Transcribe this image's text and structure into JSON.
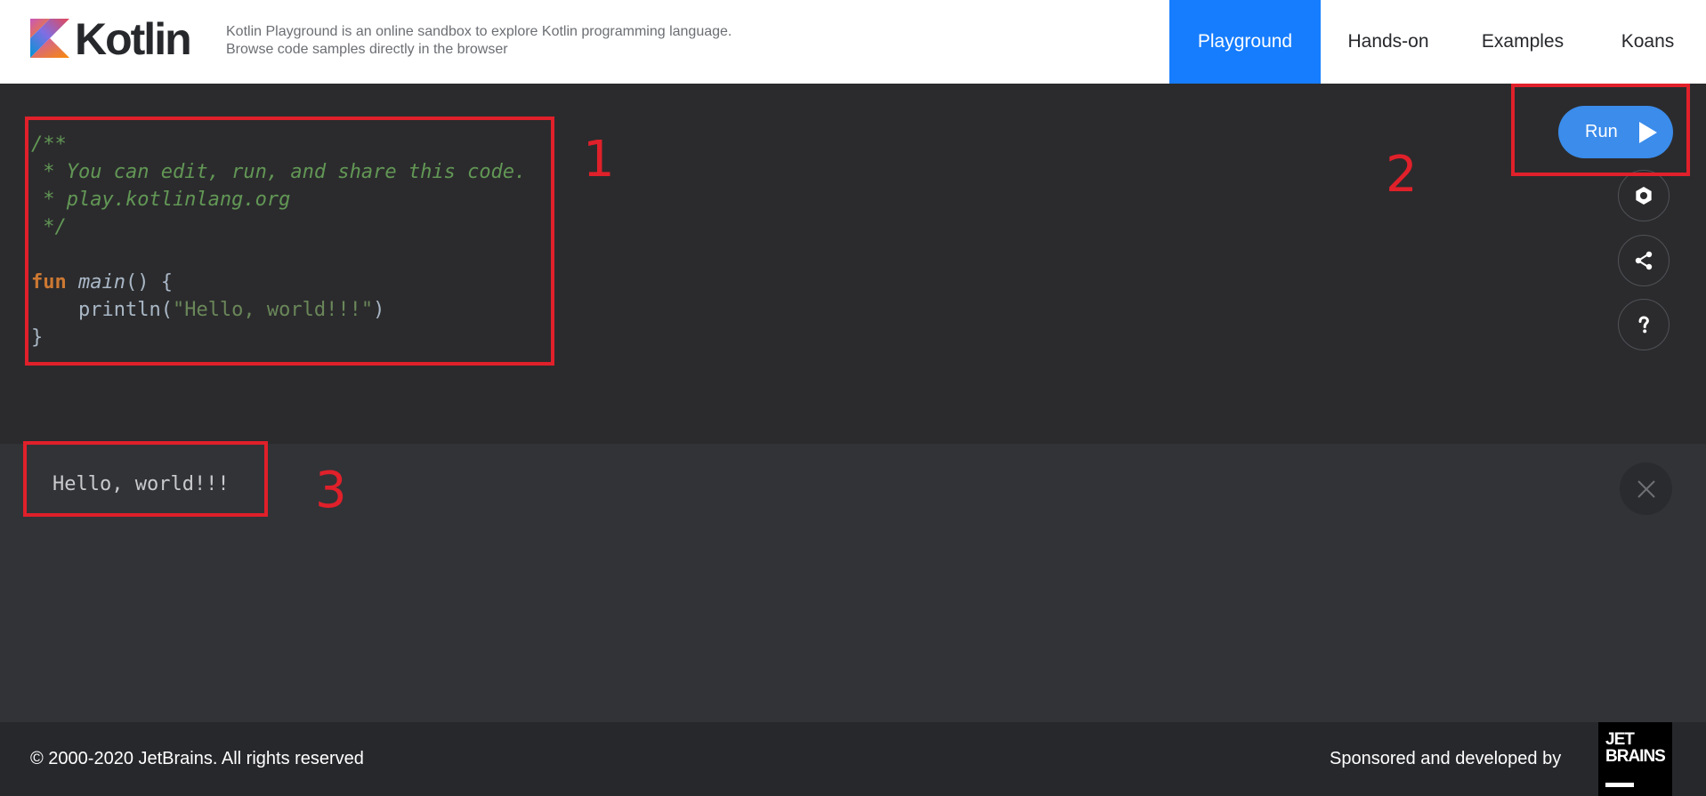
{
  "header": {
    "logo_text": "Kotlin",
    "tagline": "Kotlin Playground is an online sandbox to explore Kotlin programming language. Browse code samples directly in the browser",
    "nav": [
      "Playground",
      "Hands-on",
      "Examples",
      "Koans"
    ],
    "active_nav": "Playground"
  },
  "editor": {
    "lines": {
      "l1": "/**",
      "l2": " * You can edit, run, and share this code.",
      "l3": " * play.kotlinlang.org",
      "l4": " */",
      "l6_kw": "fun",
      "l6_fn": "main",
      "l6_rest": "() {",
      "l7_call": "    println(",
      "l7_str": "\"Hello, world!!!\"",
      "l7_end": ")",
      "l8": "}"
    },
    "run_label": "Run",
    "side_icons": [
      "settings-icon",
      "share-icon",
      "help-icon"
    ]
  },
  "output": {
    "text": "Hello, world!!!"
  },
  "annotations": [
    "1",
    "2",
    "3"
  ],
  "footer": {
    "copyright": "© 2000-2020 JetBrains. All rights reserved",
    "sponsored": "Sponsored and developed by",
    "jetbrains_logo": "JET BRAINS"
  },
  "colors": {
    "accent": "#167dff",
    "run_button": "#3b8ceb",
    "annotation": "#e0202a",
    "comment": "#629755",
    "keyword": "#cc7832",
    "string": "#6a8759"
  }
}
